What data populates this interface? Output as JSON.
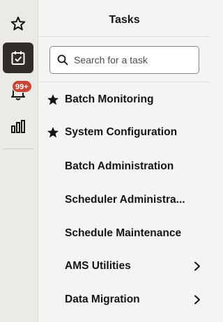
{
  "rail": {
    "items": [
      {
        "icon": "star-icon",
        "active": false
      },
      {
        "icon": "task-list-icon",
        "active": true
      },
      {
        "icon": "bell-icon",
        "active": false,
        "badge": "99+"
      },
      {
        "icon": "bar-chart-icon",
        "active": false
      }
    ]
  },
  "panel": {
    "title": "Tasks",
    "search": {
      "placeholder": "Search for a task",
      "value": ""
    },
    "tasks": [
      {
        "label": "Batch Monitoring",
        "favorite": true,
        "has_submenu": false
      },
      {
        "label": "System Configuration",
        "favorite": true,
        "has_submenu": false
      },
      {
        "label": "Batch Administration",
        "favorite": false,
        "has_submenu": false
      },
      {
        "label": "Scheduler Administra...",
        "favorite": false,
        "has_submenu": false
      },
      {
        "label": "Schedule Maintenance",
        "favorite": false,
        "has_submenu": false
      },
      {
        "label": "AMS Utilities",
        "favorite": false,
        "has_submenu": true
      },
      {
        "label": "Data Migration",
        "favorite": false,
        "has_submenu": true
      }
    ]
  },
  "colors": {
    "rail_bg": "#eceae7",
    "active_bg": "#312d2a",
    "badge_bg": "#c74634",
    "panel_bg": "#f5f4f2",
    "text": "#161513"
  }
}
